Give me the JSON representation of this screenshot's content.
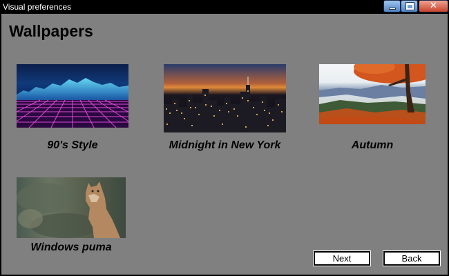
{
  "window": {
    "title": "Visual preferences",
    "controls": {
      "minimize_icon": "minimize-icon",
      "maximize_icon": "maximize-icon",
      "close_icon": "close-icon",
      "close_glyph": "✕"
    }
  },
  "page": {
    "heading": "Wallpapers"
  },
  "wallpapers": [
    {
      "label": "90's Style",
      "image": "synthwave-grid"
    },
    {
      "label": "Midnight in New York",
      "image": "city-skyline-night"
    },
    {
      "label": "Autumn",
      "image": "autumn-tree-valley"
    },
    {
      "label": "Windows puma",
      "image": "puma"
    }
  ],
  "buttons": {
    "next": "Next",
    "back": "Back"
  }
}
